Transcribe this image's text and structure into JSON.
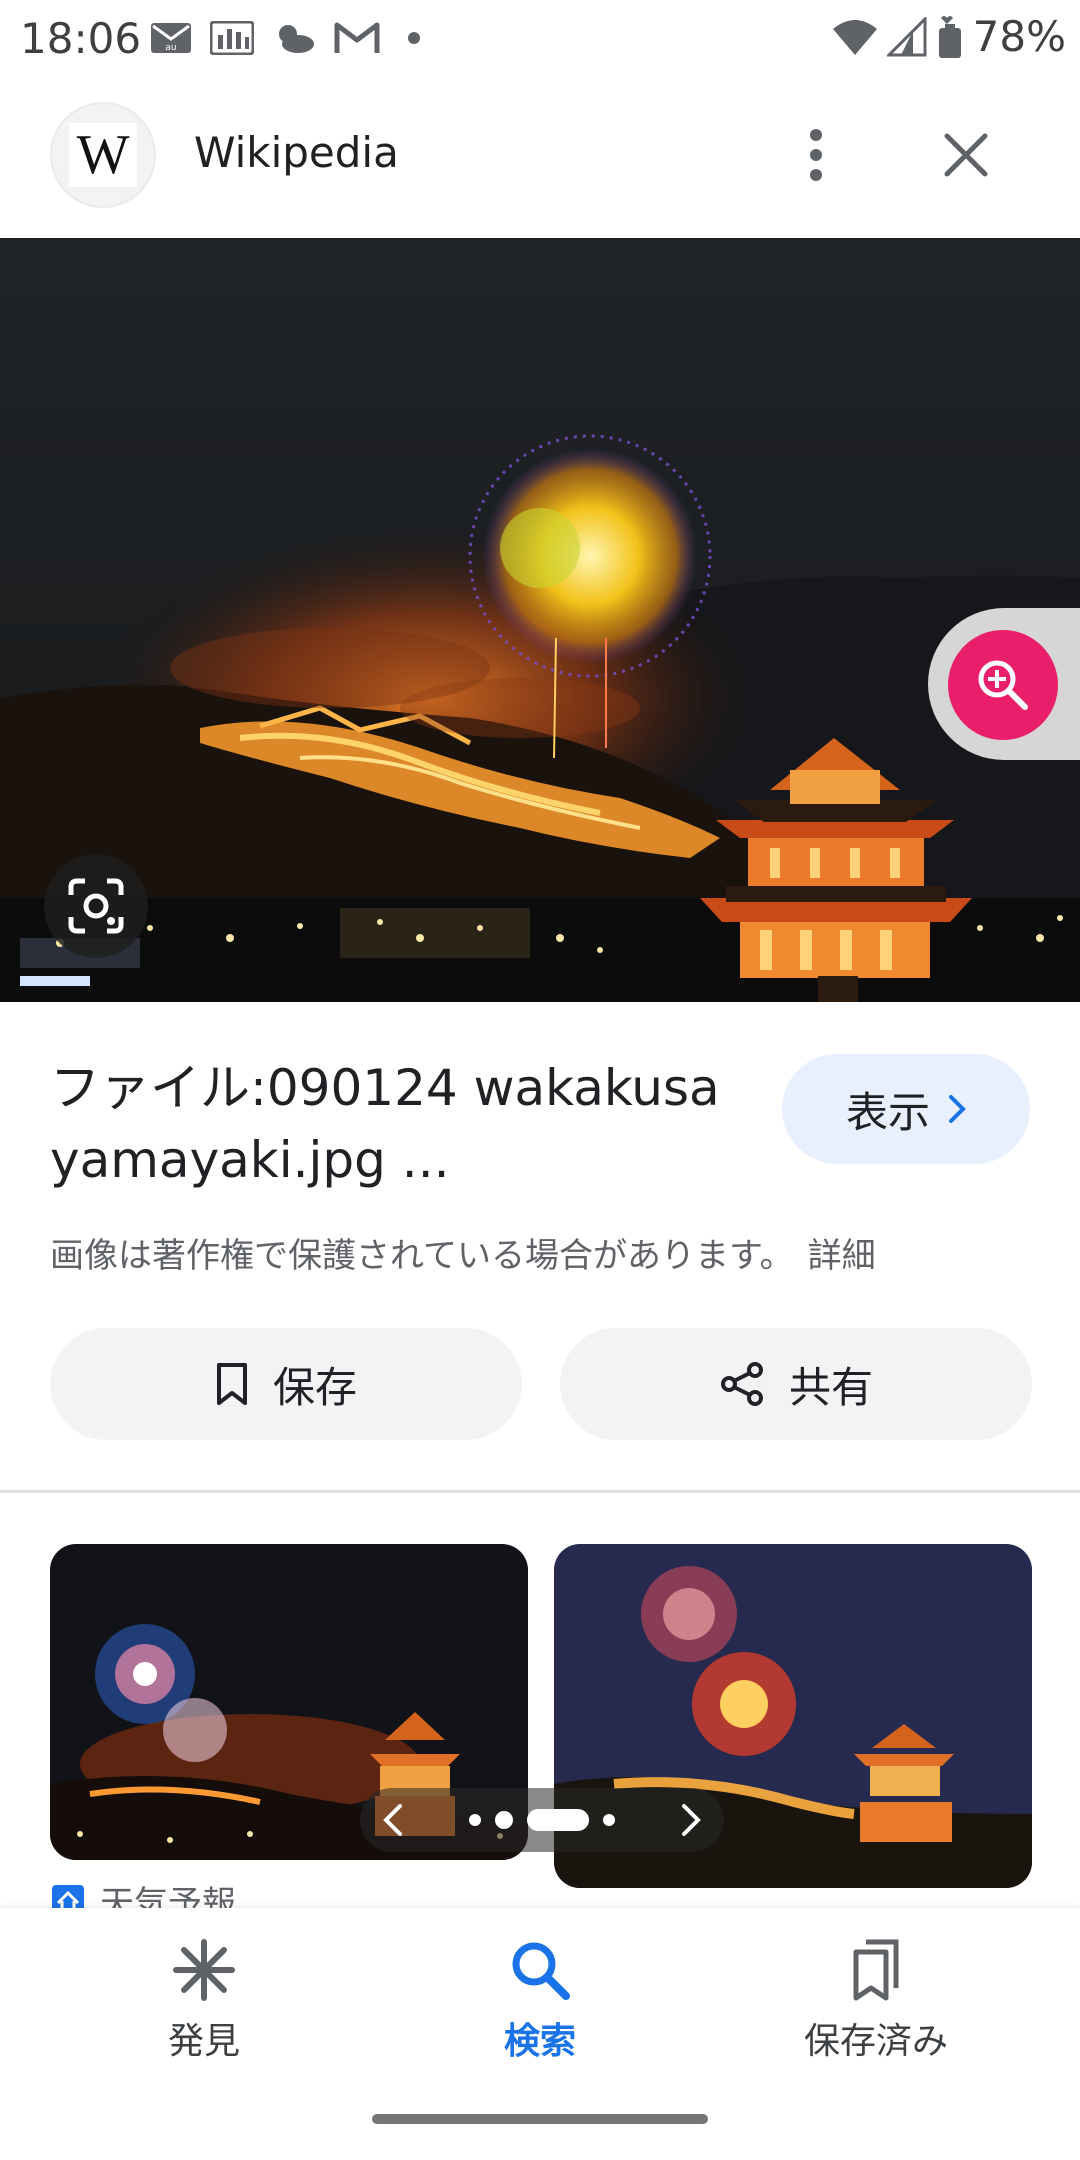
{
  "status_bar": {
    "time": "18:06",
    "battery": "78%",
    "icons": [
      "mail-au-icon",
      "gallery-icon",
      "weather-icon",
      "gmail-icon",
      "dot-icon",
      "wifi-icon",
      "signal-icon",
      "battery-icon"
    ]
  },
  "header": {
    "logo_letter": "W",
    "title": "Wikipedia"
  },
  "result": {
    "title": "ファイル:090124 wakakusa yamayaki.jpg ...",
    "show_label": "表示",
    "copyright_text": "画像は著作権で保護されている場合があります。",
    "detail_link": "詳細",
    "save_label": "保存",
    "share_label": "共有"
  },
  "related": {
    "source_label": "天気予報",
    "carousel_pages": 5,
    "carousel_active": 3
  },
  "bottom_nav": {
    "items": [
      {
        "label": "発見",
        "icon": "asterisk-icon",
        "active": false
      },
      {
        "label": "検索",
        "icon": "search-icon",
        "active": true
      },
      {
        "label": "保存済み",
        "icon": "collections-icon",
        "active": false
      }
    ]
  },
  "colors": {
    "accent": "#1a73e8",
    "zoom_button": "#ea1f6b",
    "show_button_bg": "#e8f0fe",
    "pill_bg": "#f1f3f4"
  }
}
